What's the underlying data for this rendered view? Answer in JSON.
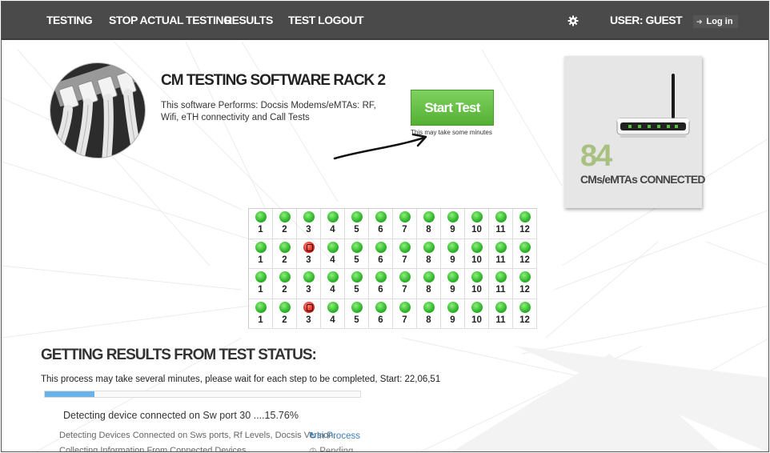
{
  "nav": {
    "items": [
      "TESTING",
      "STOP ACTUAL TESTING",
      "RESULTS",
      "TEST LOGOUT"
    ],
    "user": "USER: GUEST",
    "login": "Log in"
  },
  "intro": {
    "title": "CM TESTING SOFTWARE RACK 2",
    "description": "This software Performs: Docsis Modems/eMTAs: RF, Wifi, eTH connectivity and Call Tests",
    "start_button": "Start Test",
    "start_note": "This may take some minutes"
  },
  "connected": {
    "count": "84",
    "label": "CMs/eMTAs CONNECTED"
  },
  "ports": {
    "rows": [
      [
        "ok",
        "ok",
        "ok",
        "ok",
        "ok",
        "ok",
        "ok",
        "ok",
        "ok",
        "ok",
        "ok",
        "ok"
      ],
      [
        "ok",
        "ok",
        "fail",
        "ok",
        "ok",
        "ok",
        "ok",
        "ok",
        "ok",
        "ok",
        "ok",
        "ok"
      ],
      [
        "ok",
        "ok",
        "ok",
        "ok",
        "ok",
        "ok",
        "ok",
        "ok",
        "ok",
        "ok",
        "ok",
        "ok"
      ],
      [
        "ok",
        "ok",
        "fail",
        "ok",
        "ok",
        "ok",
        "ok",
        "ok",
        "ok",
        "ok",
        "ok",
        "ok"
      ]
    ],
    "numbers": [
      "1",
      "2",
      "3",
      "4",
      "5",
      "6",
      "7",
      "8",
      "9",
      "10",
      "11",
      "12"
    ],
    "colors": {
      "ok": "#2fb52a",
      "fail": "#d9281a"
    }
  },
  "status": {
    "title": "GETTING RESULTS FROM TEST STATUS:",
    "note": "This process may take several minutes, please wait for each step to be completed, Start: 22,06,51",
    "progress_fraction": 0.1576,
    "detect_line": "Detecting device connected on Sw port 30 ....15.76%",
    "steps": [
      {
        "label": "Detecting Devices Connected on Sws ports, Rf Levels, Docsis Version.",
        "state": "In Process",
        "icon": "refresh-icon"
      },
      {
        "label": "Collecting Information From Connected Devices",
        "state": "Pending",
        "icon": "clock-icon"
      }
    ]
  },
  "accent": "#54b033"
}
